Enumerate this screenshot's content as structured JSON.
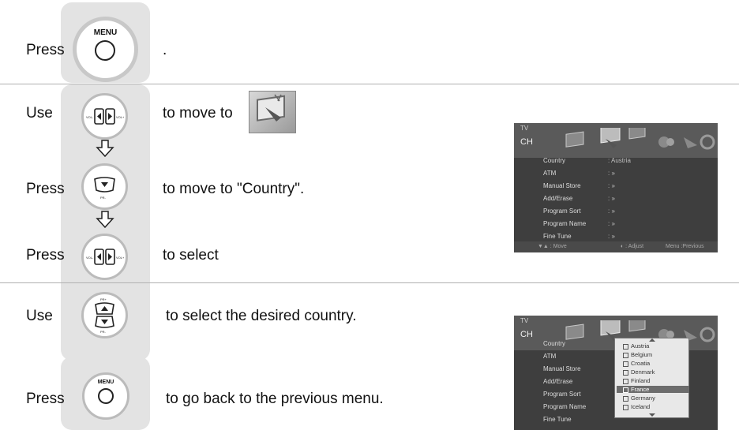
{
  "steps": [
    {
      "label": "Press",
      "text": "."
    },
    {
      "label": "Use",
      "text": "to move to"
    },
    {
      "label": "Press",
      "text": "to move to \"Country\"."
    },
    {
      "label": "Press",
      "text": "to select"
    },
    {
      "label": "Use",
      "text": "to select the desired country."
    },
    {
      "label": "Press",
      "text": "to go back to the previous menu."
    }
  ],
  "buttons": {
    "menu1": "MENU",
    "menu2": "MENU",
    "vol_minus": "VOL-",
    "vol_plus": "VOL+",
    "pr_minus": "PR-",
    "pr_plus": "PR+"
  },
  "screen1": {
    "title": "TV",
    "section": "CH",
    "items": [
      {
        "name": "Country",
        "value": ": Austria"
      },
      {
        "name": "ATM",
        "value": ": »"
      },
      {
        "name": "Manual Store",
        "value": ": »"
      },
      {
        "name": "Add/Erase",
        "value": ": »"
      },
      {
        "name": "Program Sort",
        "value": ": »"
      },
      {
        "name": "Program Name",
        "value": ": »"
      },
      {
        "name": "Fine Tune",
        "value": ": »"
      }
    ],
    "footer": {
      "move": "▼▲ : Move",
      "adjust": "◐ : Adjust",
      "menu": "Menu :Previous"
    }
  },
  "screen2": {
    "title": "TV",
    "section": "CH",
    "items": [
      "Country",
      "ATM",
      "Manual Store",
      "Add/Erase",
      "Program Sort",
      "Program Name",
      "Fine Tune"
    ],
    "countries": [
      "Austria",
      "Belgium",
      "Croatia",
      "Denmark",
      "Finland",
      "France",
      "Germany",
      "Iceland"
    ],
    "highlighted": "France"
  },
  "icon_names": [
    "menu-button-icon",
    "vol-left-right-button-icon",
    "channel-menu-icon",
    "pr-down-button-icon",
    "pr-up-down-button-icon",
    "arrow-down-icon"
  ]
}
